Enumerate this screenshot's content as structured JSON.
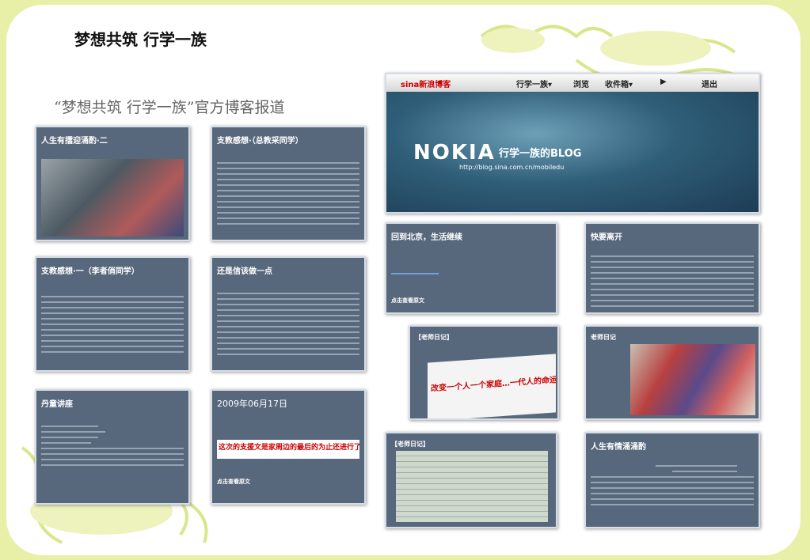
{
  "page": {
    "title": "梦想共筑  行学一族",
    "subtitle": "“梦想共筑  行学一族”官方博客报道"
  },
  "blog_header": {
    "nav_items": [
      "行学一族▾",
      "浏览",
      "收件箱▾",
      "退出"
    ],
    "brand": "NOKIA",
    "blog_name": "行学一族的BLOG",
    "url": "http://blog.sina.com.cn/mobiledu"
  },
  "posts": [
    {
      "title": "人生有擂迎涌酌·二"
    },
    {
      "title": "支教感想·（总教采同学）"
    },
    {
      "title": "回到北京，生活继续"
    },
    {
      "title": "快要离开"
    },
    {
      "title": "支教感想·一（李者俏同学）"
    },
    {
      "title": "还是信该做一点"
    },
    {
      "title": "【老师日记】"
    },
    {
      "title": "老师日记"
    },
    {
      "title": "丹童讲座"
    },
    {
      "title": "2009年06月17日"
    },
    {
      "title": "【老师日记】"
    },
    {
      "title": "人生有情涌涌酌"
    }
  ],
  "banner_texts": {
    "post10": "这次的支援文是家周边的最后的为止还进行了一场。在这次意识的以前所，需要注意",
    "slogan": "改变一个人一个家庭…一代人的命运"
  },
  "links": {
    "read_all": "点击查看原文"
  },
  "colors": {
    "card_bg": "#58687c",
    "frame_accent": "#e8f0a8"
  }
}
